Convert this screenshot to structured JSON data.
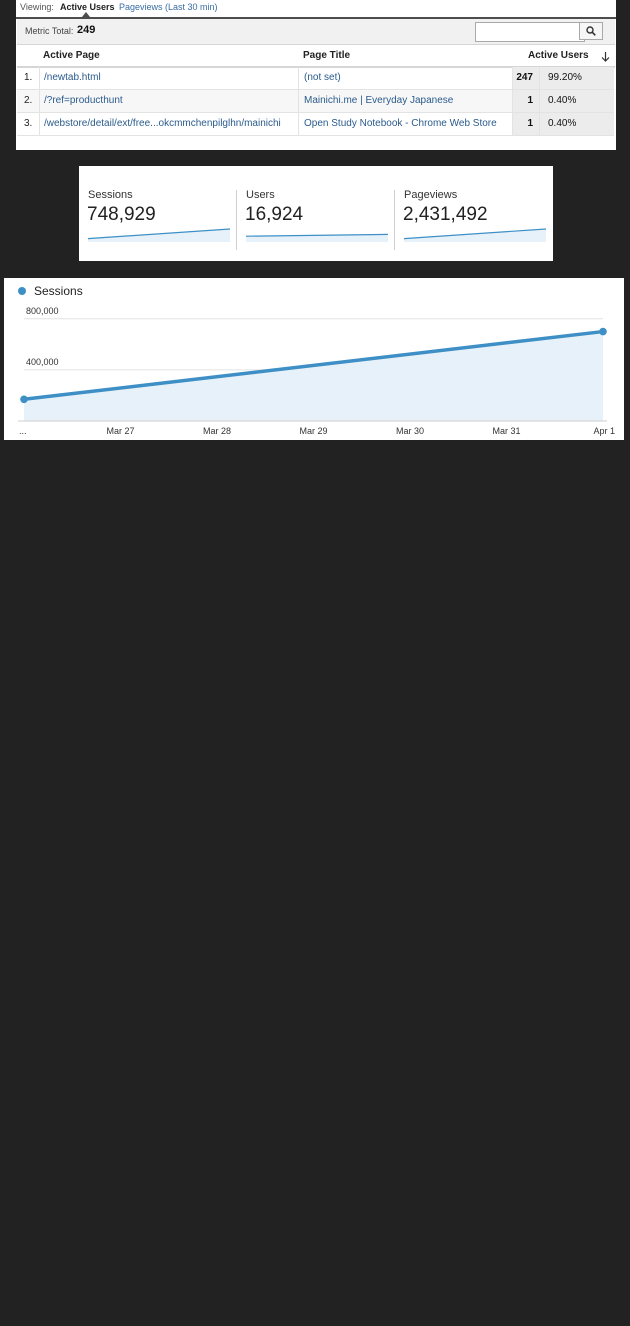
{
  "realtime": {
    "viewing_label": "Viewing:",
    "tab_active": "Active Users",
    "tab_other": "Pageviews (Last 30 min)",
    "metric_total_label": "Metric Total:",
    "metric_total_value": "249",
    "search_placeholder": "",
    "columns": {
      "page": "Active Page",
      "title": "Page Title",
      "users": "Active Users"
    },
    "rows": [
      {
        "num": "1.",
        "page": "/newtab.html",
        "title": "(not set)",
        "users": "247",
        "pct": "99.20%"
      },
      {
        "num": "2.",
        "page": "/?ref=producthunt",
        "title": "Mainichi.me | Everyday Japanese",
        "users": "1",
        "pct": "0.40%"
      },
      {
        "num": "3.",
        "page": "/webstore/detail/ext/free...okcmmchenpilglhn/mainichi",
        "title": "Open Study Notebook - Chrome Web Store",
        "users": "1",
        "pct": "0.40%"
      }
    ]
  },
  "summary": {
    "items": [
      {
        "label": "Sessions",
        "value": "748,929",
        "trend": [
          0.2,
          1.0
        ]
      },
      {
        "label": "Users",
        "value": "16,924",
        "trend": [
          0.4,
          0.55
        ]
      },
      {
        "label": "Pageviews",
        "value": "2,431,492",
        "trend": [
          0.2,
          1.0
        ]
      }
    ]
  },
  "chart_data": {
    "type": "area",
    "legend": [
      "Sessions"
    ],
    "x_labels": [
      "...",
      "Mar 27",
      "Mar 28",
      "Mar 29",
      "Mar 30",
      "Mar 31",
      "Apr 1"
    ],
    "y_ticks": [
      "800,000",
      "400,000"
    ],
    "ylim": [
      0,
      900000
    ],
    "series": [
      {
        "name": "Sessions",
        "points": [
          {
            "x": "...",
            "y": 170000
          },
          {
            "x": "Apr 1",
            "y": 700000
          }
        ]
      }
    ],
    "color": "#3d8fc6",
    "fill": "#e6f1f9",
    "grid": true,
    "legend_position": "top-left"
  }
}
